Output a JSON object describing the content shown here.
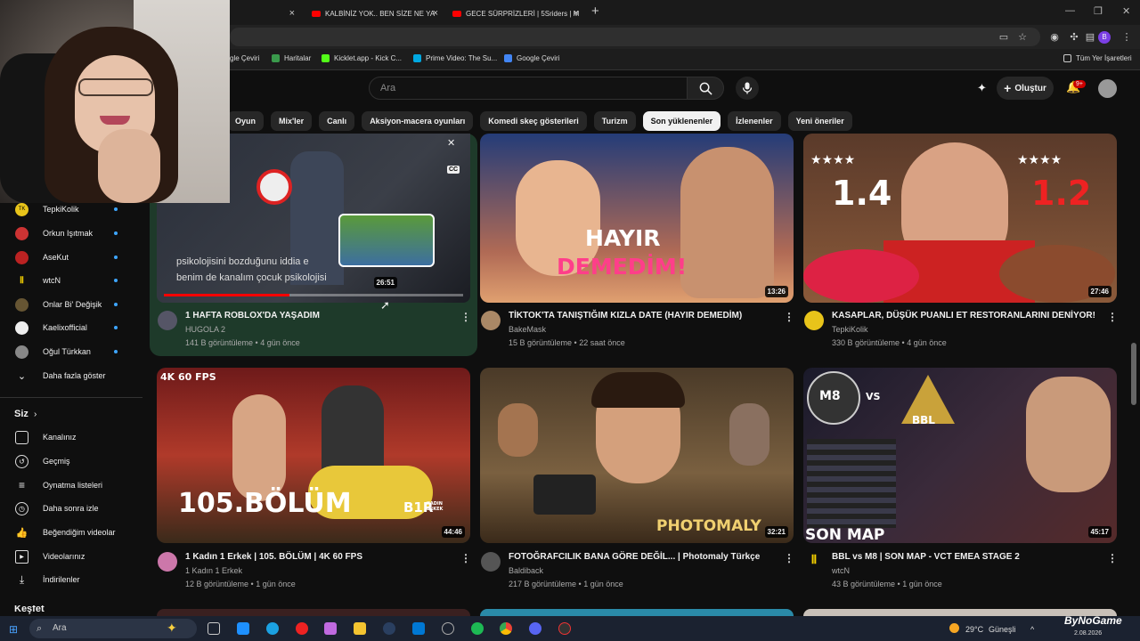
{
  "browser": {
    "tabs": [
      {
        "label": "KALBİNİZ YOK.. BEN SİZE NE YA"
      },
      {
        "label": "GECE SÜRPRİZLERİ | 5Sriders | M"
      }
    ],
    "bookmarks": [
      {
        "label": "gle Çeviri"
      },
      {
        "label": "Haritalar"
      },
      {
        "label": "Kicklet.app - Kick C..."
      },
      {
        "label": "Prime Video: The Su..."
      },
      {
        "label": "Google Çeviri"
      },
      {
        "label": "Tüm Yer İşaretleri"
      }
    ],
    "profile": "B"
  },
  "header": {
    "search_placeholder": "Ara",
    "create_label": "Oluştur",
    "notif_count": "9+"
  },
  "chips": [
    "Oyun",
    "Mix'ler",
    "Canlı",
    "Aksiyon-macera oyunları",
    "Komedi skeç gösterileri",
    "Turizm",
    "Son yüklenenler",
    "İzlenenler",
    "Yeni öneriler"
  ],
  "sidebar": {
    "subs": [
      {
        "label": "TepkiKolik",
        "color": "#e8c41a"
      },
      {
        "label": "Orkun Işıtmak",
        "color": "#c33"
      },
      {
        "label": "AseKut",
        "color": "#b22"
      },
      {
        "label": "wtcN",
        "color": "#f4d000"
      },
      {
        "label": "Onlar Bi' Değişik",
        "color": "#665533"
      },
      {
        "label": "Kaelixofficial",
        "color": "#eee"
      },
      {
        "label": "Oğul Türkkan",
        "color": "#888"
      }
    ],
    "more": "Daha fazla göster",
    "you_title": "Siz",
    "you": [
      {
        "label": "Kanalınız"
      },
      {
        "label": "Geçmiş"
      },
      {
        "label": "Oynatma listeleri"
      },
      {
        "label": "Daha sonra izle"
      },
      {
        "label": "Beğendiğim videolar"
      },
      {
        "label": "Videolarınız"
      },
      {
        "label": "İndirilenler"
      }
    ],
    "next_title": "Keşfet"
  },
  "videos": [
    {
      "title": "1 HAFTA ROBLOX'DA YAŞADIM",
      "channel": "HUGOLA 2",
      "meta": "141 B görüntüleme • 4 gün önce",
      "duration": "26:51",
      "caption": "psikolojisini bozduğunu iddia e",
      "caption2": "benim de kanalım çocuk psikolojisi",
      "cc": "CC",
      "progress": 0.42
    },
    {
      "title": "TİKTOK'TA TANIŞTIĞIM KIZLA DATE (HAYIR DEMEDİM)",
      "channel": "BakeMask",
      "meta": "15 B görüntüleme • 22 saat önce",
      "duration": "13:26",
      "overlay1": "HAYIR",
      "overlay2": "DEMEDİM!"
    },
    {
      "title": "KASAPLAR, DÜŞÜK PUANLI ET RESTORANLARINI DENİYOR!",
      "channel": "TepkiKolik",
      "meta": "330 B görüntüleme • 4 gün önce",
      "duration": "27:46",
      "overlay1": "1.4",
      "overlay2": "1.2"
    },
    {
      "title": "1 Kadın 1 Erkek | 105. BÖLÜM | 4K 60 FPS",
      "channel": "1 Kadın 1 Erkek",
      "meta": "12 B görüntüleme • 1 gün önce",
      "duration": "44:46",
      "overlay1": "4K 60 FPS",
      "overlay2": "105.BÖLÜM",
      "overlay3": "B1R",
      "overlay4": "KADIN ERKEK"
    },
    {
      "title": "FOTOĞRAFCILIK BANA GÖRE DEĞİL... | Photomaly Türkçe",
      "channel": "Baldiback",
      "meta": "217 B görüntüleme • 1 gün önce",
      "duration": "32:21",
      "overlay1": "PHOTOMALY"
    },
    {
      "title": "BBL vs M8 | SON MAP - VCT EMEA STAGE 2",
      "channel": "wtcN",
      "meta": "43 B görüntüleme • 1 gün önce",
      "duration": "45:17",
      "overlay1": "SON MAP",
      "overlay2": "M8",
      "overlay3": "VS",
      "overlay4": "BBL"
    }
  ],
  "taskbar": {
    "search": "Ara",
    "weather": "29°C",
    "weather_label": "Güneşli",
    "date": "2.08.2026",
    "watermark": "ByNoGame"
  }
}
